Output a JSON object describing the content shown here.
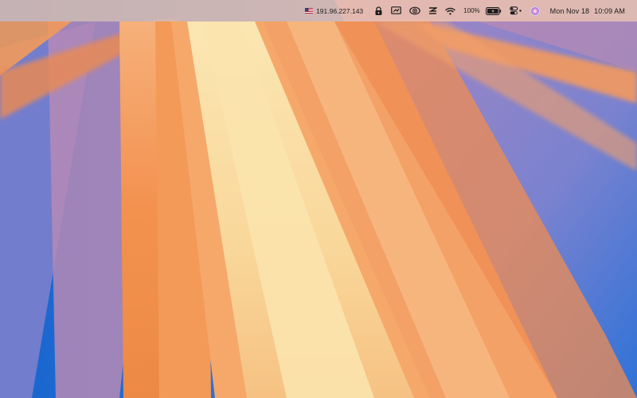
{
  "menubar": {
    "vpn_ip": "191.96.227.143",
    "vpn_flag_icon": "us-flag-icon",
    "status_icons": [
      "lock-app-icon",
      "screen-display-icon",
      "eye-app-icon",
      "stacked-app-icon",
      "wifi-icon"
    ],
    "battery_percent": "100%",
    "battery_icon": "battery-charging-icon",
    "control_center_icon": "control-center-icon",
    "siri_icon": "siri-icon",
    "date": "Mon Nov 18",
    "time": "10:09 AM"
  },
  "wallpaper": {
    "name": "macOS Sequoia orange-purple light rays",
    "colors": {
      "deep_blue": "#1a6fd0",
      "purple": "#8b7dc8",
      "orange": "#f08a4a",
      "peach": "#f6b07a",
      "cream": "#fbe0a5"
    }
  }
}
